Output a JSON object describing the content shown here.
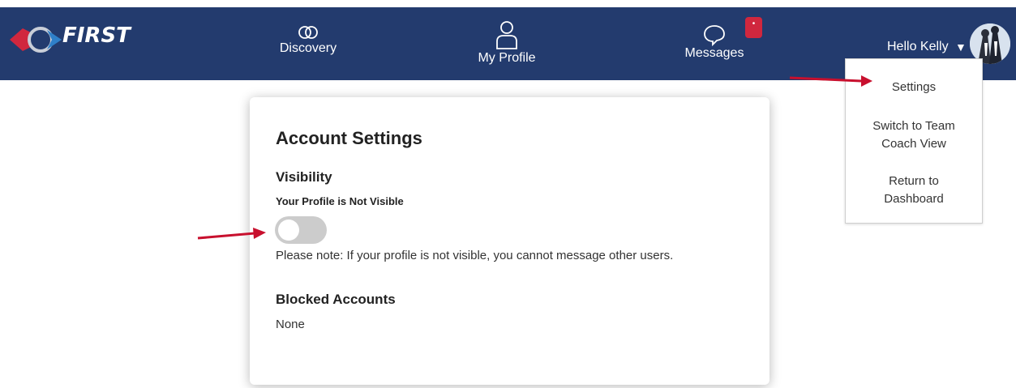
{
  "colors": {
    "nav_bg": "#233b6e",
    "accent_red": "#d0273e",
    "annotation_arrow": "#c8102e",
    "toggle_off": "#cccccc"
  },
  "header": {
    "logo_text": "FIRST",
    "logo_icon": "first-logo-icon",
    "nav": [
      {
        "label": "Discovery",
        "icon": "infinity-rings-icon"
      },
      {
        "label": "My Profile",
        "icon": "person-icon"
      },
      {
        "label": "Messages",
        "icon": "chat-bubble-icon"
      }
    ],
    "messages_badge": "•",
    "greeting": "Hello Kelly",
    "caret_icon": "caret-down-icon"
  },
  "dropdown": {
    "items": [
      {
        "label": "Settings"
      },
      {
        "label": "Switch to Team Coach View"
      },
      {
        "label": "Return to Dashboard"
      }
    ]
  },
  "settings": {
    "title": "Account Settings",
    "visibility": {
      "heading": "Visibility",
      "status": "Your Profile is Not Visible",
      "toggle_on": false,
      "note": "Please note: If your profile is not visible, you cannot message other users."
    },
    "blocked": {
      "heading": "Blocked Accounts",
      "value": "None"
    }
  }
}
